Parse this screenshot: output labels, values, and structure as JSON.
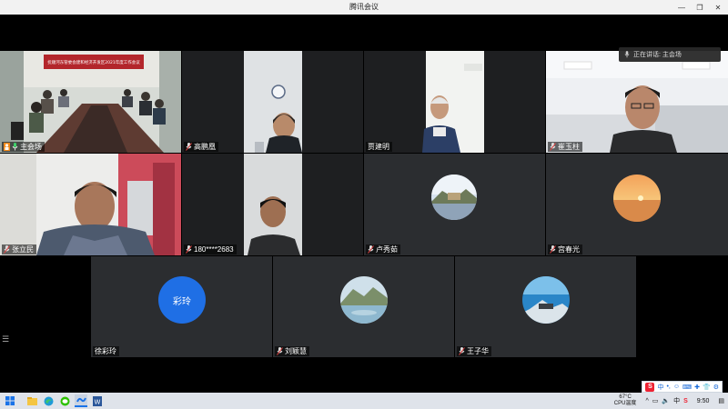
{
  "window": {
    "title": "腾讯会议",
    "controls": [
      "—",
      "❐",
      "✕"
    ]
  },
  "speaking": {
    "text": "正在讲话: 主会场"
  },
  "meeting": {
    "banner_text": "抚顺河东管委会建和经济开发区2021年度工作会议"
  },
  "participants": [
    {
      "name": "主会场",
      "type": "video"
    },
    {
      "name": "高鹏凰",
      "type": "video"
    },
    {
      "name": "贾建明",
      "type": "video"
    },
    {
      "name": "崔玉柱",
      "type": "video"
    },
    {
      "name": "张立民",
      "type": "video"
    },
    {
      "name": "180****2683",
      "type": "video"
    },
    {
      "name": "卢秀茹",
      "type": "avatar"
    },
    {
      "name": "宫春光",
      "type": "avatar"
    },
    {
      "name": "徐彩玲",
      "type": "avatar",
      "avatar_text": "彩玲"
    },
    {
      "name": "刘颖慧",
      "type": "avatar"
    },
    {
      "name": "王子华",
      "type": "avatar"
    }
  ],
  "taskbar": {
    "weather_temp": "67°C",
    "weather_label": "CPU温度",
    "lang": "中",
    "time": "9:50",
    "apps": [
      "windows-start",
      "file-explorer",
      "edge",
      "wechat",
      "meeting",
      "word"
    ]
  },
  "ime": {
    "logo": "S",
    "items": [
      "中",
      "•,",
      "☺",
      "⌨",
      "✚",
      "👕",
      "⚙"
    ]
  },
  "colors": {
    "tile_bg": "#2b2d30",
    "avatar_blue": "#1f6fe5",
    "taskbar": "#dfe3ea"
  }
}
